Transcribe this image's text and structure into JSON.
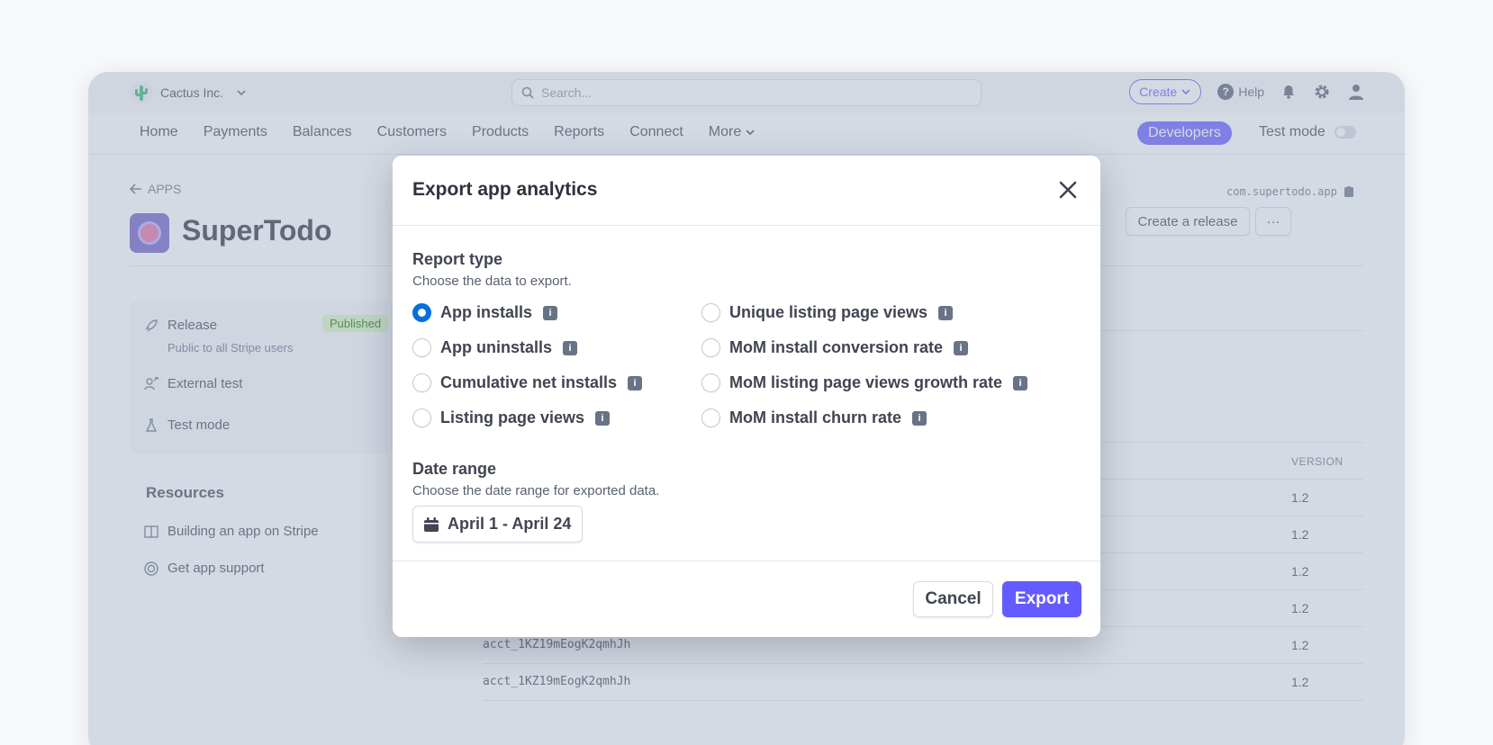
{
  "topbar": {
    "account_name": "Cactus Inc.",
    "search_placeholder": "Search...",
    "create_label": "Create",
    "help_label": "Help"
  },
  "nav": {
    "items": [
      "Home",
      "Payments",
      "Balances",
      "Customers",
      "Products",
      "Reports",
      "Connect"
    ],
    "more_label": "More",
    "developers_label": "Developers",
    "test_mode_label": "Test mode"
  },
  "page": {
    "back_label": "APPS",
    "app_name": "SuperTodo",
    "app_id": "com.supertodo.app",
    "create_release_label": "Create a release",
    "more_actions_label": "···"
  },
  "sidebar": {
    "release_label": "Release",
    "release_badge": "Published",
    "release_sub": "Public to all Stripe users",
    "external_test_label": "External test",
    "test_mode_label": "Test mode",
    "resources_title": "Resources",
    "building_label": "Building an app on Stripe",
    "support_label": "Get app support"
  },
  "table": {
    "version_header": "VERSION",
    "rows": [
      {
        "account": "",
        "version": "1.2"
      },
      {
        "account": "",
        "version": "1.2"
      },
      {
        "account": "",
        "version": "1.2"
      },
      {
        "account": "",
        "version": "1.2"
      },
      {
        "account": "acct_1KZ19mEogK2qmhJh",
        "version": "1.2"
      },
      {
        "account": "acct_1KZ19mEogK2qmhJh",
        "version": "1.2"
      }
    ]
  },
  "modal": {
    "title": "Export app analytics",
    "report_type_title": "Report type",
    "report_type_sub": "Choose the data to export.",
    "options_left": [
      {
        "label": "App installs",
        "checked": true
      },
      {
        "label": "App uninstalls",
        "checked": false
      },
      {
        "label": "Cumulative net installs",
        "checked": false
      },
      {
        "label": "Listing page views",
        "checked": false
      }
    ],
    "options_right": [
      {
        "label": "Unique listing page views",
        "checked": false
      },
      {
        "label": "MoM install conversion rate",
        "checked": false
      },
      {
        "label": "MoM listing page views growth rate",
        "checked": false
      },
      {
        "label": "MoM install churn rate",
        "checked": false
      }
    ],
    "date_range_title": "Date range",
    "date_range_sub": "Choose the date range for exported data.",
    "date_range_value": "April 1 - April 24",
    "cancel_label": "Cancel",
    "export_label": "Export"
  },
  "colors": {
    "accent": "#635bff",
    "radio_checked": "#0570de"
  }
}
